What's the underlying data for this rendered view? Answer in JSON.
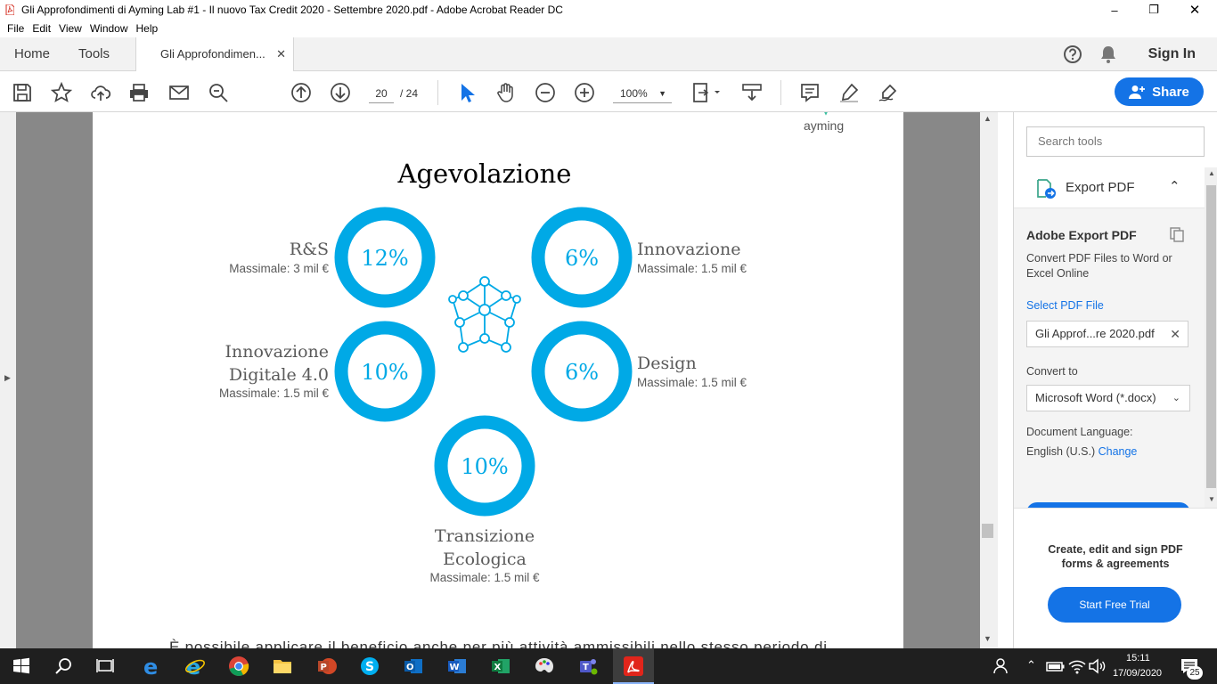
{
  "window": {
    "title": "Gli Approfondimenti di Ayming Lab #1 - Il nuovo Tax Credit 2020 - Settembre 2020.pdf - Adobe Acrobat Reader DC"
  },
  "menu": [
    "File",
    "Edit",
    "View",
    "Window",
    "Help"
  ],
  "tabs": {
    "home": "Home",
    "tools": "Tools",
    "document": "Gli Approfondimen...",
    "sign_in": "Sign In"
  },
  "toolbar": {
    "page_current": "20",
    "page_total": "/ 24",
    "zoom": "100%",
    "share": "Share"
  },
  "document": {
    "logo": "ayming",
    "heading": "Agevolazione",
    "items": [
      {
        "title_lines": [
          "R&S"
        ],
        "cap": "Massimale: 3 mil €",
        "percent": "12%"
      },
      {
        "title_lines": [
          "Innovazione"
        ],
        "cap": "Massimale: 1.5 mil €",
        "percent": "6%"
      },
      {
        "title_lines": [
          "Innovazione",
          "Digitale 4.0"
        ],
        "cap": "Massimale: 1.5 mil €",
        "percent": "10%"
      },
      {
        "title_lines": [
          "Design"
        ],
        "cap": "Massimale: 1.5 mil €",
        "percent": "6%"
      },
      {
        "title_lines": [
          "Transizione",
          "Ecologica"
        ],
        "cap": "Massimale: 1.5 mil €",
        "percent": "10%"
      }
    ],
    "body_text": "È possibile applicare il beneficio anche per più attività ammissibili nello stesso periodo di"
  },
  "panel": {
    "search_placeholder": "Search tools",
    "export_header": "Export PDF",
    "title": "Adobe Export PDF",
    "description": "Convert PDF Files to Word or Excel Online",
    "select_file": "Select PDF File",
    "file_name": "Gli Approf...re 2020.pdf",
    "convert_to_label": "Convert to",
    "convert_to_value": "Microsoft Word (*.docx)",
    "doc_lang_label": "Document Language:",
    "doc_lang_value": "English (U.S.)",
    "change": "Change",
    "promo_text": "Create, edit and sign PDF forms & agreements",
    "trial_button": "Start Free Trial"
  },
  "taskbar": {
    "time": "15:11",
    "date": "17/09/2020",
    "notifications": "25"
  },
  "colors": {
    "accent": "#1473e6",
    "pdf_cyan": "#00a9e6"
  }
}
